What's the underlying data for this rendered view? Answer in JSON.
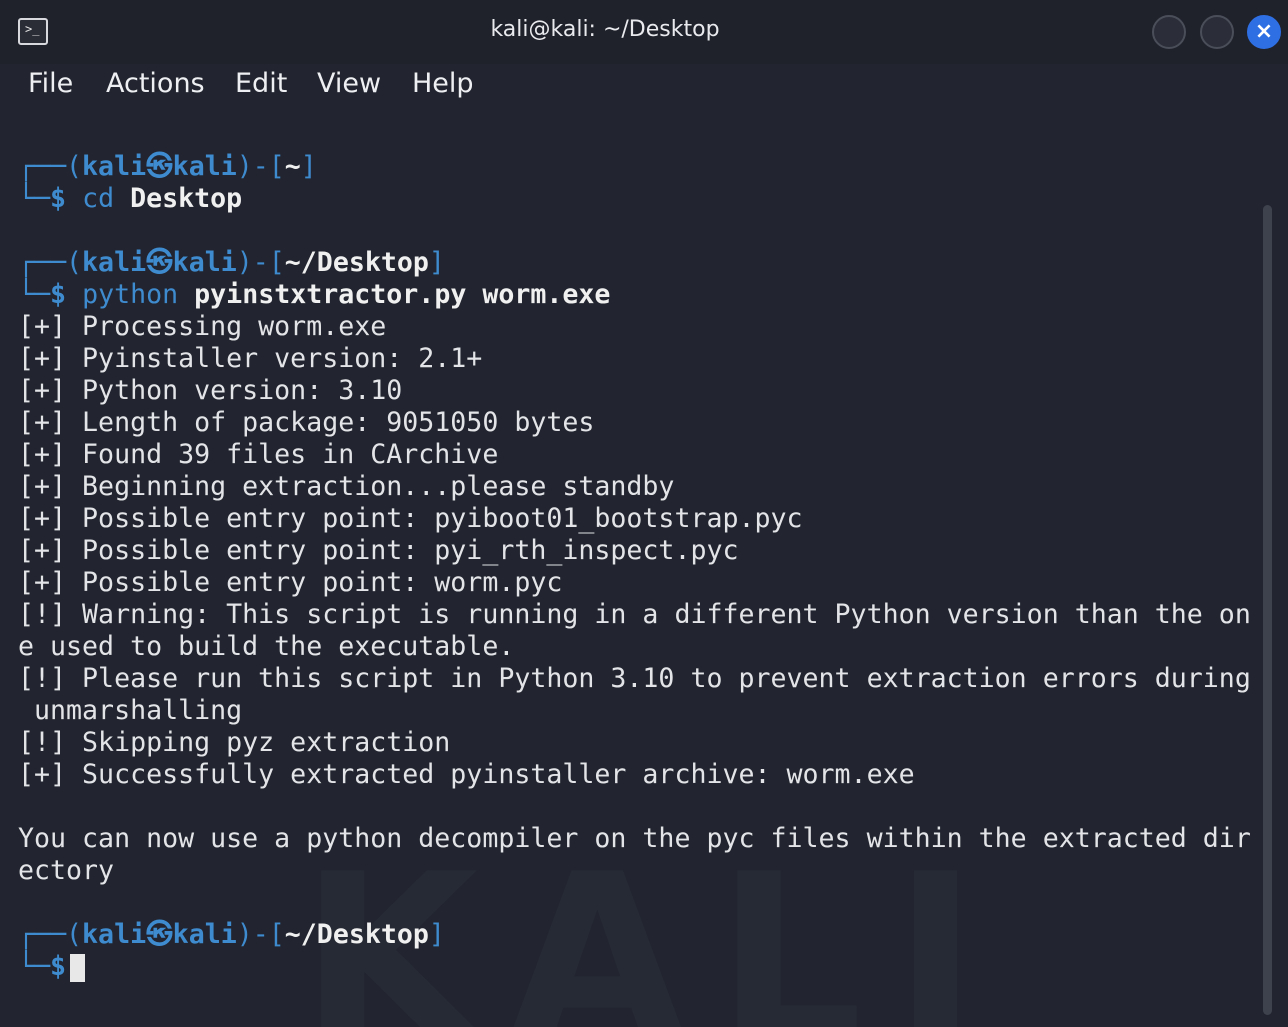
{
  "window": {
    "title": "kali@kali: ~/Desktop",
    "app_icon": "terminal-icon"
  },
  "menu": [
    "File",
    "Actions",
    "Edit",
    "View",
    "Help"
  ],
  "terminal": {
    "user_host": "kali㉿kali",
    "prompts": [
      {
        "dir": "~",
        "cmd": "cd",
        "args": "Desktop"
      },
      {
        "dir": "~/Desktop",
        "cmd": "python",
        "args": "pyinstxtractor.py worm.exe"
      },
      {
        "dir": "~/Desktop",
        "cmd": "",
        "args": ""
      }
    ],
    "output": [
      "[+] Processing worm.exe",
      "[+] Pyinstaller version: 2.1+",
      "[+] Python version: 3.10",
      "[+] Length of package: 9051050 bytes",
      "[+] Found 39 files in CArchive",
      "[+] Beginning extraction...please standby",
      "[+] Possible entry point: pyiboot01_bootstrap.pyc",
      "[+] Possible entry point: pyi_rth_inspect.pyc",
      "[+] Possible entry point: worm.pyc",
      "[!] Warning: This script is running in a different Python version than the on",
      "e used to build the executable.",
      "[!] Please run this script in Python 3.10 to prevent extraction errors during",
      " unmarshalling",
      "[!] Skipping pyz extraction",
      "[+] Successfully extracted pyinstaller archive: worm.exe",
      "",
      "You can now use a python decompiler on the pyc files within the extracted dir",
      "ectory"
    ],
    "watermark": "KALI"
  },
  "colors": {
    "background": "#22252f",
    "prompt": "#3f8bcf",
    "text": "#e3e4e7",
    "close_button": "#2f6fe4"
  }
}
